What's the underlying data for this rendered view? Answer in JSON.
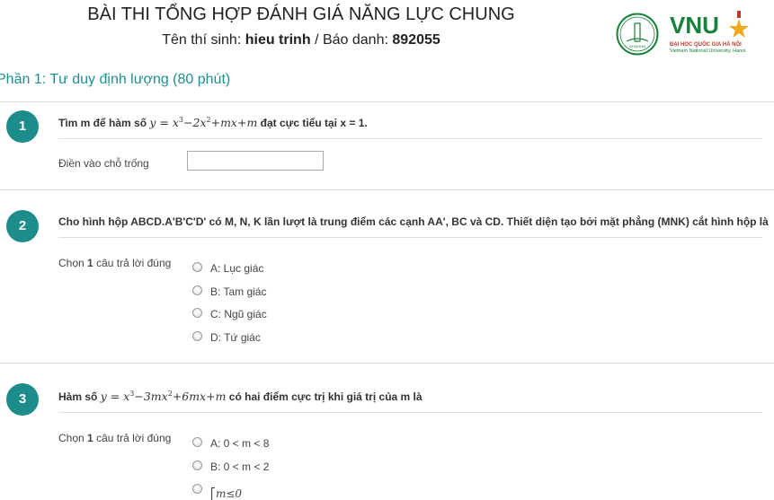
{
  "header": {
    "title": "BÀI THI TỔNG HỢP ĐÁNH GIÁ NĂNG LỰC CHUNG",
    "candidate_label": "Tên thí sinh:",
    "candidate_name": "hieu trinh",
    "separator": "/",
    "id_label": "Báo danh:",
    "id_value": "892055"
  },
  "logo": {
    "circle_text": "ĐHQGHN",
    "brand": "VNU",
    "sub1": "ĐẠI HỌC QUỐC GIA HÀ NỘI",
    "sub2": "Vietnam National University, Hanoi",
    "colors": {
      "green": "#17813a",
      "red": "#c0392b",
      "gold": "#f2a81d"
    }
  },
  "section": {
    "title": "Phần 1: Tư duy định lượng (80 phút)"
  },
  "questions": [
    {
      "number": "1",
      "text_before": "Tìm m để hàm số",
      "text_after": "đạt cực tiểu tại x = 1.",
      "answer_label": "Điền vào chỗ trống",
      "answer_value": ""
    },
    {
      "number": "2",
      "text": "Cho hình hộp ABCD.A'B'C'D' có M, N, K lần lượt là trung điểm các cạnh AA', BC và CD. Thiết diện tạo bởi mặt phẳng (MNK) cắt hình hộp là",
      "choose_prefix": "Chọn",
      "choose_count": "1",
      "choose_suffix": "câu trả lời đúng",
      "options": [
        "A: Lục giác",
        "B: Tam giác",
        "C: Ngũ giác",
        "D: Tứ giác"
      ]
    },
    {
      "number": "3",
      "text_before": "Hàm số",
      "text_after": "có hai điểm cực trị khi giá trị của m là",
      "choose_prefix": "Chọn",
      "choose_count": "1",
      "choose_suffix": "câu trả lời đúng",
      "options": [
        "A: 0 < m < 8",
        "B: 0 < m < 2",
        "m≤0"
      ]
    }
  ],
  "colors": {
    "accent": "#1c8d8b",
    "section_title": "#1e8f8e",
    "divider": "#dddddd"
  }
}
